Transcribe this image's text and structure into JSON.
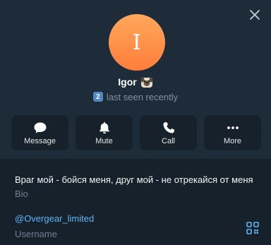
{
  "profile": {
    "avatar_letter": "I",
    "name": "Igor",
    "emoji": "pug-emoji",
    "badge": "2",
    "status": "last seen recently"
  },
  "actions": [
    {
      "label": "Message",
      "icon": "chat-bubble-icon"
    },
    {
      "label": "Mute",
      "icon": "bell-icon"
    },
    {
      "label": "Call",
      "icon": "phone-icon"
    },
    {
      "label": "More",
      "icon": "more-dots-icon"
    }
  ],
  "info": {
    "bio": "Враг мой - бойся меня, друг мой - не отрекайся от меня",
    "bio_caption": "Bio",
    "username": "@Overgear_limited",
    "username_caption": "Username"
  },
  "colors": {
    "background": "#17212b",
    "header": "#1e2c3a",
    "accent": "#5eb5f7",
    "avatar": "#ff8c42",
    "secondary_text": "#7f91a4"
  }
}
